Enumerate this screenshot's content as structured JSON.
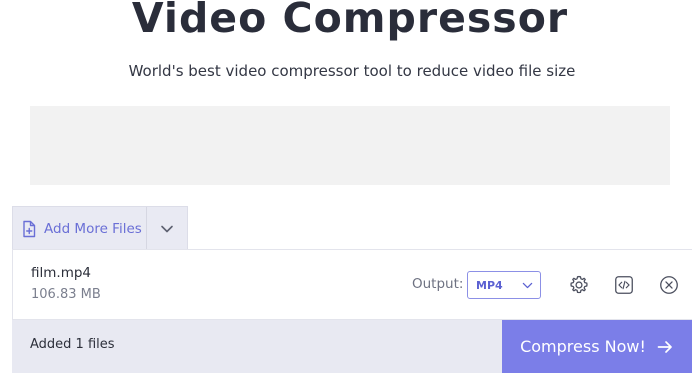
{
  "header": {
    "title": "Video Compressor",
    "subtitle": "World's best video compressor tool to reduce video file size"
  },
  "toolbar": {
    "add_files_label": "Add More Files",
    "add_icon": "file-plus-icon",
    "dropdown_icon": "chevron-down-icon"
  },
  "file": {
    "name": "film.mp4",
    "size": "106.83 MB",
    "output_label": "Output:",
    "format_selected": "MP4",
    "actions": [
      "gear-icon",
      "embed-code-icon",
      "close-circle-icon"
    ]
  },
  "footer": {
    "added_text": "Added 1 files",
    "compress_label": "Compress Now!",
    "compress_icon": "arrow-right-icon"
  },
  "colors": {
    "accent": "#7b7ee8",
    "accent_text": "#6a6fd6",
    "panel_bg": "#e8e9f2",
    "title": "#2a2d3a"
  }
}
